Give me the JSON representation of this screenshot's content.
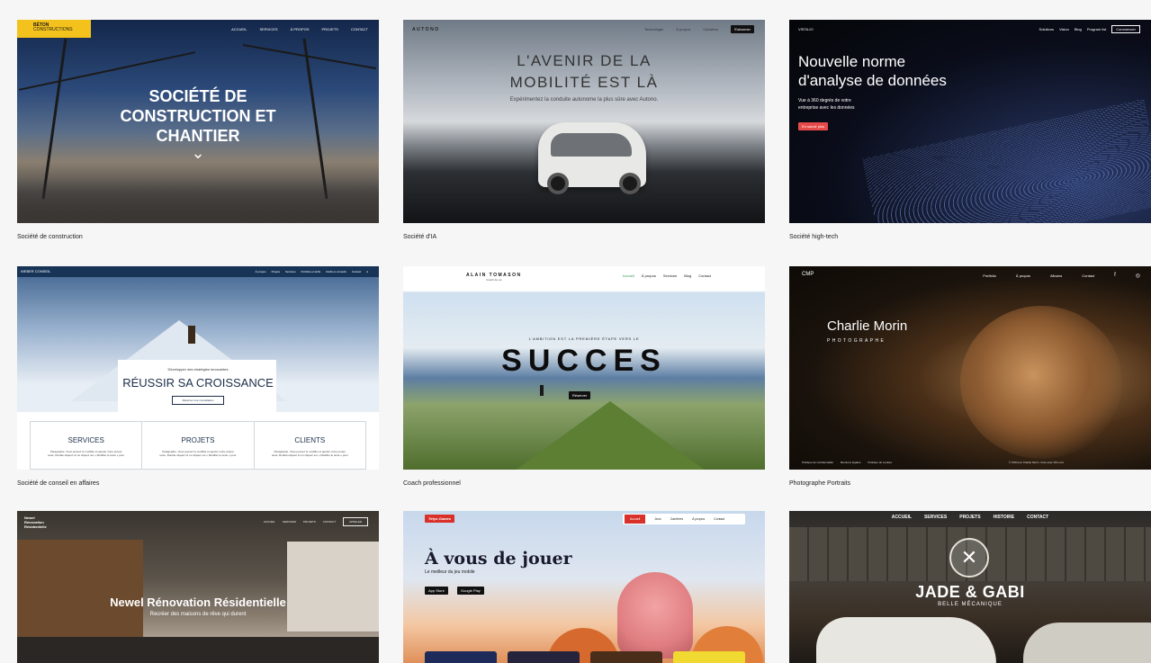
{
  "templates": [
    {
      "caption": "Société de construction",
      "logo_line1": "BÉTON",
      "logo_line2": "CONSTRUCTIONS",
      "nav": [
        "ACCUEIL",
        "SERVICES",
        "À PROPOS",
        "PROJETS",
        "CONTACT"
      ],
      "hero_line1": "SOCIÉTÉ DE",
      "hero_line2": "CONSTRUCTION ET",
      "hero_line3": "CHANTIER",
      "scroll_glyph": "⌄"
    },
    {
      "caption": "Société d'IA",
      "logo": "AUTONO",
      "nav": [
        "Technologie",
        "À propos",
        "Carrières"
      ],
      "nav_button": "S'abonner",
      "hero_line1": "L'AVENIR DE LA",
      "hero_line2": "MOBILITÉ EST LÀ",
      "subtitle": "Expérimentez la conduite autonome la plus sûre avec Autono."
    },
    {
      "caption": "Société high-tech",
      "logo": "VISTA.IO",
      "nav": [
        "Solutions",
        "Vision",
        "Blog",
        "Program list"
      ],
      "nav_button": "Commencer",
      "hero_line1": "Nouvelle norme",
      "hero_line2": "d'analyse de données",
      "sub_line1": "Vue à 360 degrés de votre",
      "sub_line2": "entreprise avec les données",
      "cta": "En savoir plus"
    },
    {
      "caption": "Société de conseil en affaires",
      "logo": "WEBER CONSEIL",
      "nav": [
        "À propos",
        "Projets",
        "Services",
        "Portfolio et tarifs",
        "Outils et conseils",
        "Contact"
      ],
      "kicker": "Développer des stratégies innovantes",
      "hero": "RÉUSSIR SA CROISSANCE",
      "cta": "Réserver une consultation",
      "columns": [
        {
          "title": "SERVICES",
          "text": "Paragraphe. Vous pouvez le modifier et ajouter votre propre texte. Double-cliquez ici ou cliquez sur « Modifier le texte » pour"
        },
        {
          "title": "PROJETS",
          "text": "Paragraphe. Vous pouvez le modifier et ajouter votre propre texte. Double-cliquez ici ou cliquez sur « Modifier le texte » pour"
        },
        {
          "title": "CLIENTS",
          "text": "Paragraphe. Vous pouvez le modifier et ajouter votre propre texte. Double-cliquez ici ou cliquez sur « Modifier le texte » pour"
        }
      ]
    },
    {
      "caption": "Coach professionnel",
      "logo": "ALAIN TOMASON",
      "logo_sub": "Coach de vie",
      "nav": [
        "Accueil",
        "À propos",
        "Services",
        "Blog",
        "Contact"
      ],
      "kicker": "L'AMBITION EST LA PREMIÈRE ÉTAPE VERS LE",
      "hero": "SUCCES",
      "cta": "Réserver"
    },
    {
      "caption": "Photographe Portraits",
      "logo": "CMP",
      "nav": [
        "Portfolio",
        "À propos",
        "Albums",
        "Contact"
      ],
      "name": "Charlie Morin",
      "role": "PHOTOGRAPHE",
      "footer_links": [
        "Politique de confidentialité",
        "Mentions légales",
        "Politique de cookies"
      ],
      "footer_right": "© 2023 par Charlie Morin. Créé avec Wix.com"
    },
    {
      "caption": "",
      "logo_line1": "Newel",
      "logo_line2": "Rénovation",
      "logo_line3": "Résidentielle",
      "nav": [
        "ACCUEIL",
        "SERVICES",
        "PROJETS",
        "CONTACT"
      ],
      "nav_button": "APPELER",
      "hero": "Newel Rénovation Résidentielle",
      "subtitle": "Recréer des maisons de rêve qui durent"
    },
    {
      "caption": "",
      "logo": "Tetyo Games",
      "nav": [
        "Accueil",
        "Jeux",
        "Carrières",
        "À propos",
        "Contact"
      ],
      "hero": "À vous de jouer",
      "subtitle": "Le meilleur du jeu mobile",
      "store1": "App Store",
      "store2": "Google Play"
    },
    {
      "caption": "",
      "nav": [
        "ACCUEIL",
        "SERVICES",
        "PROJETS",
        "HISTOIRE",
        "CONTACT"
      ],
      "hero": "JADE & GABI",
      "subtitle": "BELLE MÉCANIQUE",
      "badge_glyph": "✕"
    }
  ],
  "colors": {
    "page_bg": "#f6f6f6",
    "caption_text": "#222222",
    "beton_yellow": "#f4c21c",
    "vista_red": "#e84a4a",
    "games_red": "#d9302a",
    "coach_green": "#3aa05a"
  }
}
